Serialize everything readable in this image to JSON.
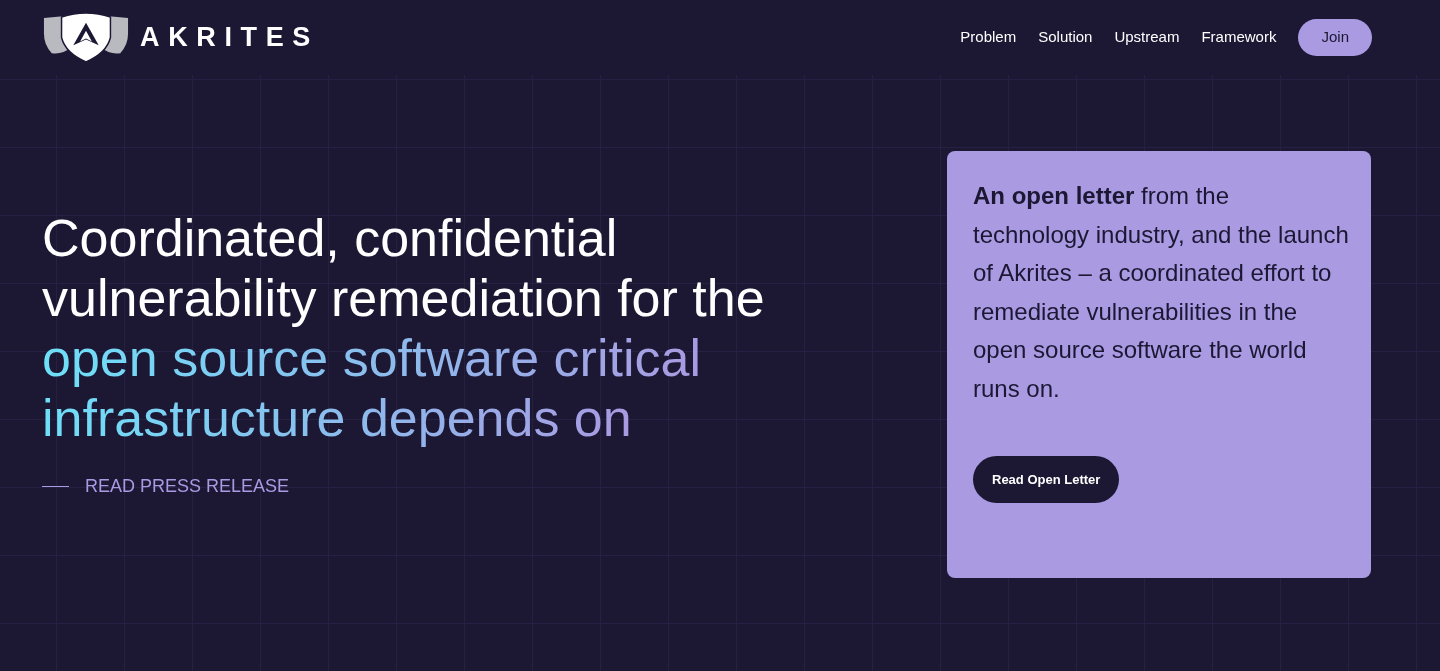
{
  "header": {
    "logo": {
      "wordmark": "AKRITES"
    },
    "nav": [
      "Problem",
      "Solution",
      "Upstream",
      "Framework"
    ],
    "join_button": "Join"
  },
  "hero": {
    "heading": "Coordinated, confidential vulnerability remediation for the",
    "heading_highlight": "open source software critical infrastructure depends on",
    "press_link": "READ PRESS RELEASE"
  },
  "letter_card": {
    "text": "**An open letter** from the technology industry, and the launch of Akrites – a coordinated effort to remediate vulnerabilities in the open source software the world runs on.",
    "button": "Read Open Letter"
  }
}
